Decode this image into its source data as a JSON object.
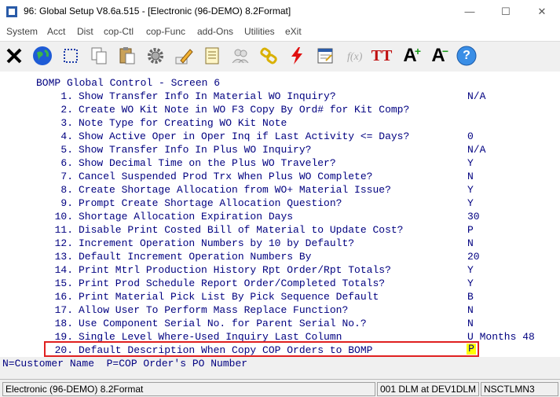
{
  "window": {
    "title": "96: Global Setup V8.6a.515 - [Electronic (96-DEMO) 8.2Format]",
    "minimize": "—",
    "maximize": "☐",
    "close": "✕"
  },
  "menu": [
    "System",
    "Acct",
    "Dist",
    "cop-Ctl",
    "cop-Func",
    "add-Ons",
    "Utilities",
    "eXit"
  ],
  "toolbar": {
    "icons": [
      "close-x-icon",
      "globe-icon",
      "select-rect-icon",
      "copy-icon",
      "paste-icon",
      "gear-icon",
      "pencil-icon",
      "notepad-icon",
      "users-icon",
      "link-icon",
      "lightning-icon",
      "form-icon",
      "function-icon",
      "font-tt-icon",
      "font-increase-icon",
      "font-decrease-icon",
      "help-icon"
    ],
    "tt_label": "TT",
    "aplus_label": "A",
    "aminus_label": "A",
    "help_label": "?"
  },
  "screen": {
    "header": "BOMP Global Control - Screen 6",
    "items": [
      {
        "num": "1.",
        "text": "Show Transfer Info In Material WO Inquiry?",
        "value": "N/A"
      },
      {
        "num": "2.",
        "text": "Create WO Kit Note in WO F3 Copy By Ord# for Kit Comp?",
        "value": ""
      },
      {
        "num": "3.",
        "text": "Note Type for Creating WO Kit Note",
        "value": ""
      },
      {
        "num": "4.",
        "text": "Show Active Oper in Oper Inq if Last Activity <= Days?",
        "value": "0"
      },
      {
        "num": "5.",
        "text": "Show Transfer Info In Plus WO Inquiry?",
        "value": "N/A"
      },
      {
        "num": "6.",
        "text": "Show Decimal Time on the Plus WO Traveler?",
        "value": "Y"
      },
      {
        "num": "7.",
        "text": "Cancel Suspended Prod Trx When Plus WO Complete?",
        "value": "N"
      },
      {
        "num": "8.",
        "text": "Create Shortage Allocation from WO+ Material Issue?",
        "value": "Y"
      },
      {
        "num": "9.",
        "text": "Prompt Create Shortage Allocation Question?",
        "value": "Y"
      },
      {
        "num": "10.",
        "text": "Shortage Allocation Expiration Days",
        "value": "30"
      },
      {
        "num": "11.",
        "text": "Disable Print Costed Bill of Material to Update Cost?",
        "value": "P"
      },
      {
        "num": "12.",
        "text": "Increment Operation Numbers by 10 by Default?",
        "value": "N"
      },
      {
        "num": "13.",
        "text": "Default Increment Operation Numbers By",
        "value": "20"
      },
      {
        "num": "14.",
        "text": "Print Mtrl Production History Rpt Order/Rpt Totals?",
        "value": "Y"
      },
      {
        "num": "15.",
        "text": "Print Prod Schedule Report Order/Completed Totals?",
        "value": "Y"
      },
      {
        "num": "16.",
        "text": "Print Material Pick List By Pick Sequence Default",
        "value": "B"
      },
      {
        "num": "17.",
        "text": "Allow User To Perform Mass Replace Function?",
        "value": "N"
      },
      {
        "num": "18.",
        "text": "Use Component Serial No. for Parent Serial No.?",
        "value": "N"
      },
      {
        "num": "19.",
        "text": "Single Level Where-Used Inquiry Last Column",
        "value": "U Months 48"
      },
      {
        "num": "20.",
        "text": "Default Description When Copy COP Orders to BOMP",
        "value": "P"
      }
    ]
  },
  "help_line": "N=Customer Name  P=COP Order's PO Number",
  "status": {
    "company": "Electronic (96-DEMO) 8.2Format",
    "session": "001 DLM at DEV1DLM",
    "terminal": "NSCTLMN3"
  }
}
